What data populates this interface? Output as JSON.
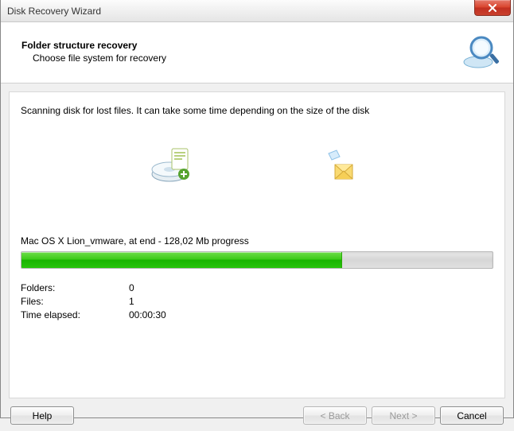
{
  "window": {
    "title": "Disk Recovery Wizard"
  },
  "header": {
    "heading": "Folder structure recovery",
    "sub": "Choose file system for recovery"
  },
  "body": {
    "scanning_text": "Scanning disk for lost files. It can take some time depending on the size of the disk",
    "progress_label": "Mac OS X Lion_vmware, at end - 128,02 Mb progress",
    "progress_percent": 68,
    "stats": {
      "folders_label": "Folders:",
      "folders_value": "0",
      "files_label": "Files:",
      "files_value": "1",
      "elapsed_label": "Time elapsed:",
      "elapsed_value": "00:00:30"
    }
  },
  "buttons": {
    "help": "Help",
    "back": "< Back",
    "next": "Next >",
    "cancel": "Cancel"
  },
  "icons": {
    "close": "close-icon",
    "magnifier": "magnifier-disk-icon",
    "disk": "disk-scan-icon",
    "mail": "folder-mail-icon"
  },
  "colors": {
    "progress_green_top": "#6edd4a",
    "progress_green_bottom": "#18b400",
    "close_red": "#d9452e"
  }
}
